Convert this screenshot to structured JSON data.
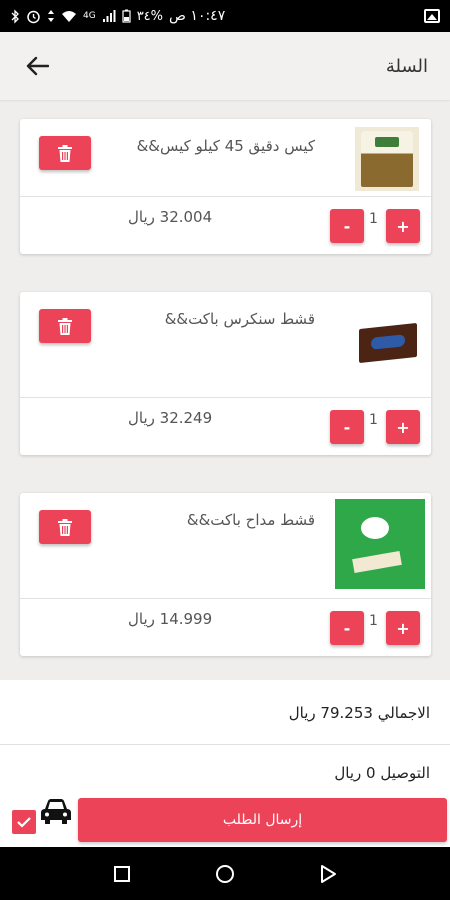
{
  "status_bar": {
    "time": "١٠:٤٧ ص",
    "battery": "%٣٤",
    "network": "4G"
  },
  "header": {
    "title": "السلة"
  },
  "cart": {
    "items": [
      {
        "name": "كيس دقيق 45 كيلو كيس&&",
        "price": "32.004 ريال",
        "quantity": "1",
        "minus": "-",
        "plus": "+"
      },
      {
        "name": "قشط سنكرس باكت&&",
        "price": "32.249 ريال",
        "quantity": "1",
        "minus": "-",
        "plus": "+"
      },
      {
        "name": "قشط مداح باكت&&",
        "price": "14.999 ريال",
        "quantity": "1",
        "minus": "-",
        "plus": "+"
      }
    ]
  },
  "totals": {
    "total": "الاجمالي 79.253 ريال",
    "delivery": "التوصيل 0 ريال"
  },
  "actions": {
    "submit_label": "إرسال الطلب"
  },
  "colors": {
    "accent": "#ec4358",
    "header_bg": "#f2f1ef",
    "page_bg": "#efeeec"
  }
}
